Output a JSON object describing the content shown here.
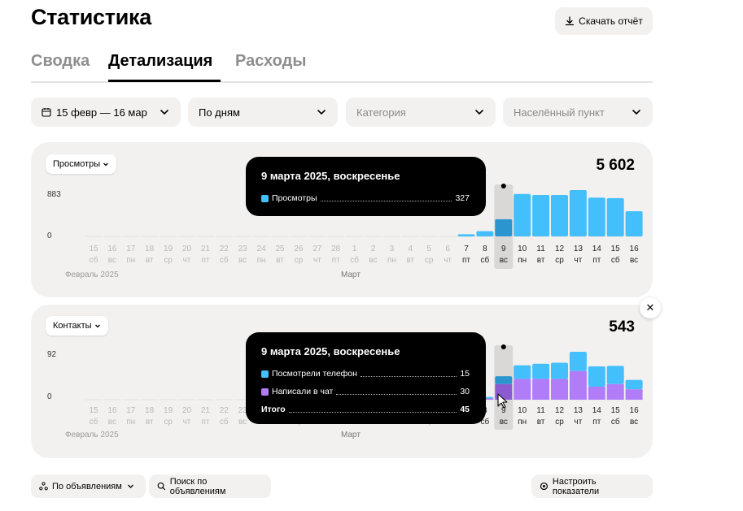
{
  "page": {
    "title": "Статистика",
    "download_label": "Скачать отчёт"
  },
  "tabs": [
    {
      "label": "Сводка"
    },
    {
      "label": "Детализация",
      "active": true
    },
    {
      "label": "Расходы"
    }
  ],
  "filters": {
    "period": "15 февр — 16 мар",
    "grouping": "По дням",
    "category_placeholder": "Категория",
    "city_placeholder": "Населённый пункт"
  },
  "colors": {
    "views": "#43bffb",
    "phone": "#43bffb",
    "chat": "#b07cf7",
    "card_bg": "#f2f1f0"
  },
  "days": [
    "15",
    "16",
    "17",
    "18",
    "19",
    "20",
    "21",
    "22",
    "23",
    "24",
    "25",
    "26",
    "27",
    "28",
    "1",
    "2",
    "3",
    "4",
    "5",
    "6",
    "7",
    "8",
    "9",
    "10",
    "11",
    "12",
    "13",
    "14",
    "15",
    "16"
  ],
  "weekdays": [
    "сб",
    "вс",
    "пн",
    "вт",
    "ср",
    "чт",
    "пт",
    "сб",
    "вс",
    "пн",
    "вт",
    "ср",
    "чт",
    "пт",
    "сб",
    "вс",
    "пн",
    "вт",
    "ср",
    "чт",
    "пт",
    "сб",
    "вс",
    "пн",
    "вт",
    "ср",
    "чт",
    "пт",
    "сб",
    "вс"
  ],
  "months": {
    "feb": "Февраль 2025",
    "mar": "Март"
  },
  "views_card": {
    "metric_label": "Просмотры",
    "total": "5 602",
    "y_max": "883",
    "y_zero": "0",
    "tooltip": {
      "title": "9 марта 2025, воскресенье",
      "row_label": "Просмотры",
      "row_value": "327"
    }
  },
  "contacts_card": {
    "metric_label": "Контакты",
    "total": "543",
    "y_max": "92",
    "y_zero": "0",
    "tooltip": {
      "title": "9 марта 2025, воскресенье",
      "phone_label": "Посмотрели телефон",
      "phone_value": "15",
      "chat_label": "Написали в чат",
      "chat_value": "30",
      "total_label": "Итого",
      "total_value": "45"
    }
  },
  "chart_data": [
    {
      "type": "bar",
      "title": "Просмотры",
      "categories": [
        "15 фев",
        "16 фев",
        "17 фев",
        "18 фев",
        "19 фев",
        "20 фев",
        "21 фев",
        "22 фев",
        "23 фев",
        "24 фев",
        "25 фев",
        "26 фев",
        "27 фев",
        "28 фев",
        "1 мар",
        "2 мар",
        "3 мар",
        "4 мар",
        "5 мар",
        "6 мар",
        "7 мар",
        "8 мар",
        "9 мар",
        "10 мар",
        "11 мар",
        "12 мар",
        "13 мар",
        "14 мар",
        "15 мар",
        "16 мар"
      ],
      "series": [
        {
          "name": "Просмотры",
          "values": [
            0,
            0,
            0,
            0,
            0,
            0,
            0,
            0,
            0,
            0,
            0,
            0,
            0,
            0,
            0,
            0,
            0,
            0,
            0,
            0,
            40,
            100,
            327,
            810,
            790,
            790,
            883,
            740,
            730,
            480
          ]
        }
      ],
      "ylim": [
        0,
        883
      ],
      "highlight_index": 22
    },
    {
      "type": "bar",
      "title": "Контакты",
      "categories": [
        "15 фев",
        "16 фев",
        "17 фев",
        "18 фев",
        "19 фев",
        "20 фев",
        "21 фев",
        "22 фев",
        "23 фев",
        "24 фев",
        "25 фев",
        "26 фев",
        "27 фев",
        "28 фев",
        "1 мар",
        "2 мар",
        "3 мар",
        "4 мар",
        "5 мар",
        "6 мар",
        "7 мар",
        "8 мар",
        "9 мар",
        "10 мар",
        "11 мар",
        "12 мар",
        "13 мар",
        "14 мар",
        "15 мар",
        "16 мар"
      ],
      "series": [
        {
          "name": "Написали в чат",
          "values": [
            0,
            0,
            0,
            0,
            0,
            0,
            0,
            0,
            0,
            0,
            0,
            0,
            0,
            0,
            0,
            0,
            0,
            0,
            0,
            0,
            0,
            2,
            30,
            40,
            40,
            40,
            55,
            25,
            30,
            20
          ]
        },
        {
          "name": "Посмотрели телефон",
          "values": [
            0,
            0,
            0,
            0,
            0,
            0,
            0,
            0,
            0,
            0,
            0,
            0,
            0,
            0,
            0,
            0,
            0,
            0,
            0,
            0,
            0,
            3,
            15,
            26,
            29,
            31,
            37,
            39,
            35,
            18
          ]
        }
      ],
      "stacked": true,
      "ylim": [
        0,
        92
      ],
      "highlight_index": 22
    }
  ],
  "bottom": {
    "by_ads_label": "По объявлениям",
    "search_label": "Поиск по объявлениям",
    "configure_label": "Настроить показатели"
  }
}
